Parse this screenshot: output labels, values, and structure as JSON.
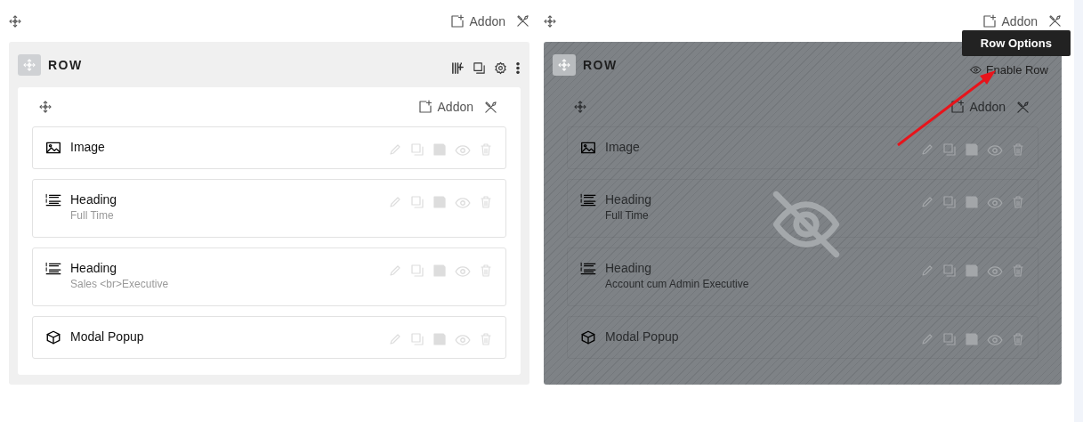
{
  "sections": [
    {
      "toolbar": {
        "addon_label": "Addon"
      },
      "row": {
        "title": "ROW",
        "disabled": false,
        "column": {
          "addon_label": "Addon",
          "addons": [
            {
              "kind": "image",
              "title": "Image"
            },
            {
              "kind": "heading",
              "title": "Heading",
              "subtitle": "Full Time"
            },
            {
              "kind": "heading",
              "title": "Heading",
              "subtitle": "Sales <br>Executive"
            },
            {
              "kind": "modal",
              "title": "Modal Popup"
            }
          ]
        }
      }
    },
    {
      "toolbar": {
        "addon_label": "Addon"
      },
      "row": {
        "title": "ROW",
        "disabled": true,
        "enable_label": "Enable Row",
        "tooltip": "Row Options",
        "column": {
          "addon_label": "Addon",
          "addons": [
            {
              "kind": "image",
              "title": "Image"
            },
            {
              "kind": "heading",
              "title": "Heading",
              "subtitle": "Full Time"
            },
            {
              "kind": "heading",
              "title": "Heading",
              "subtitle": "Account cum Admin Executive"
            },
            {
              "kind": "modal",
              "title": "Modal Popup"
            }
          ]
        }
      }
    }
  ]
}
